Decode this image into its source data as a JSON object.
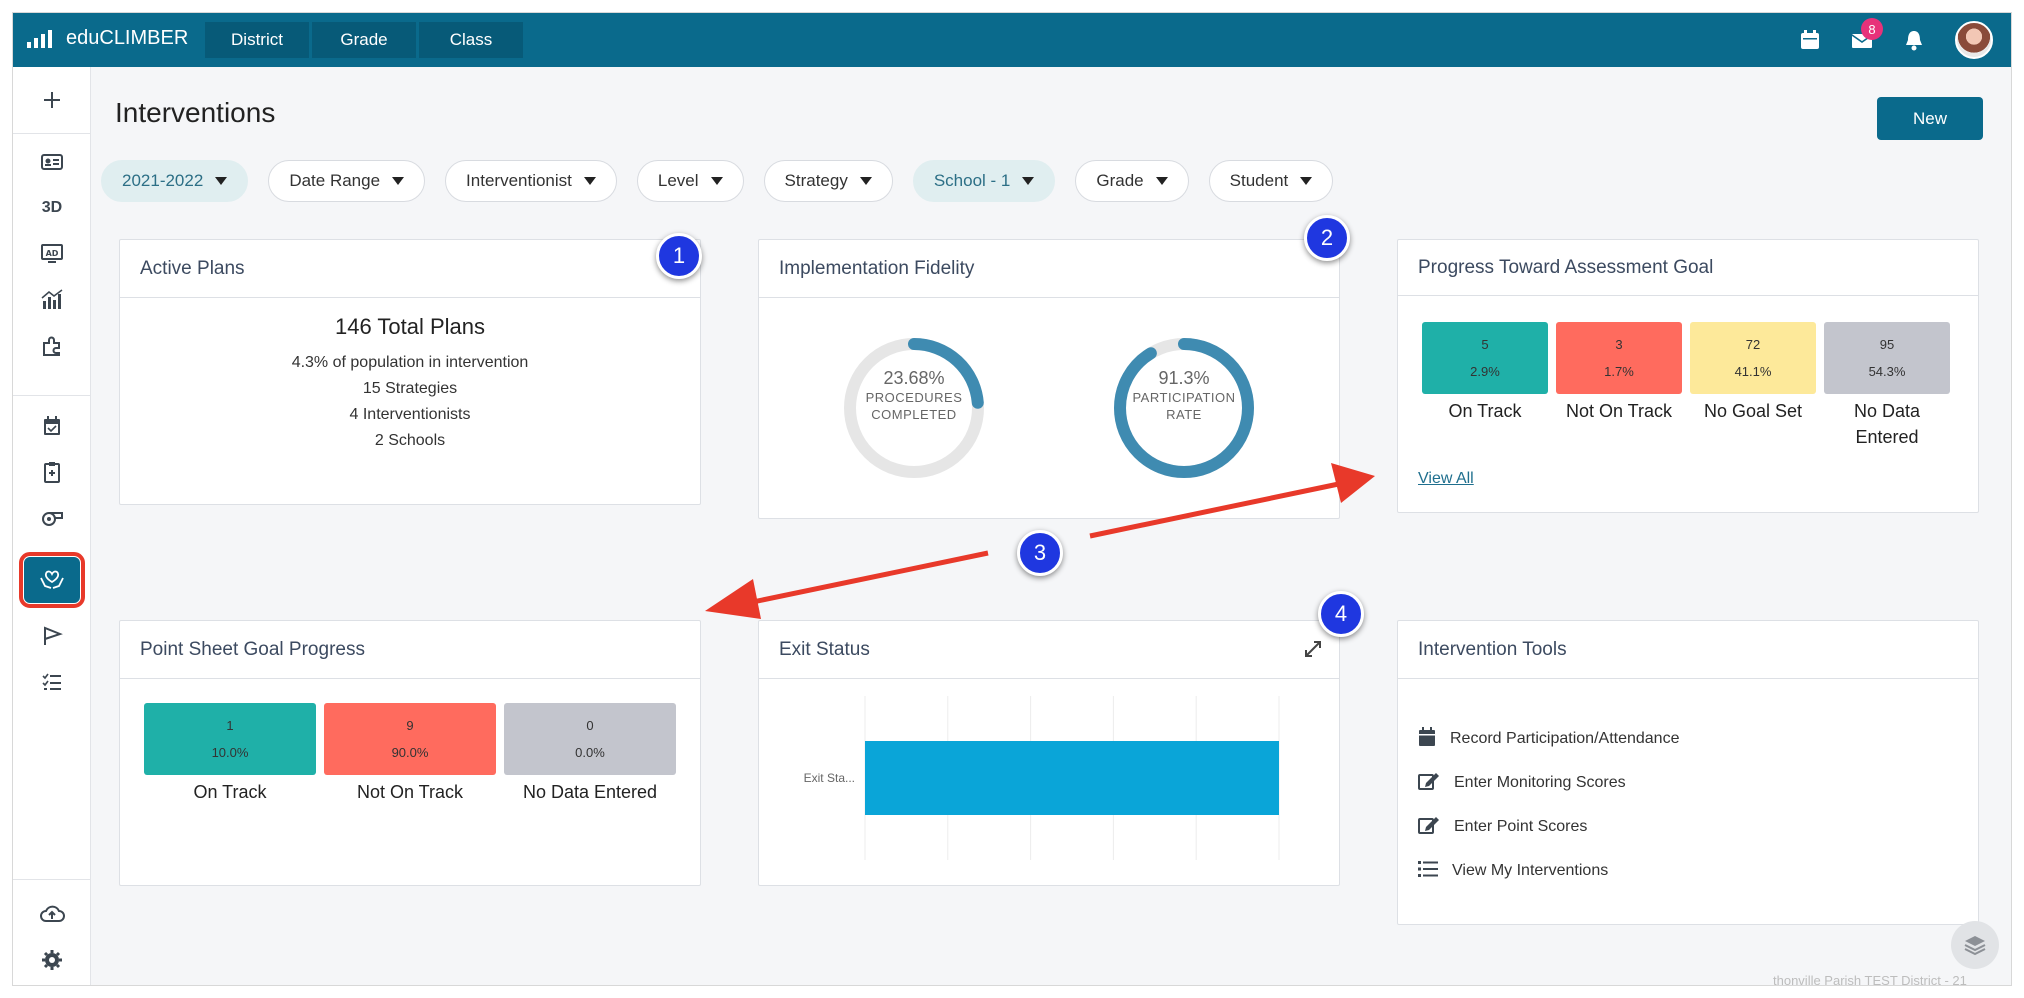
{
  "app": {
    "name": "eduCLIMBER"
  },
  "nav": {
    "tabs": [
      {
        "label": "District"
      },
      {
        "label": "Grade"
      },
      {
        "label": "Class"
      }
    ]
  },
  "header": {
    "notification_count": "8"
  },
  "page": {
    "title": "Interventions",
    "new_label": "New"
  },
  "sidebar": {
    "items": [
      "add",
      "student-card",
      "3D",
      "ad",
      "analytics",
      "puzzle",
      "calendar",
      "clipboard",
      "whistle",
      "interventions",
      "flag",
      "checklist",
      "cloud-upload",
      "settings"
    ],
    "threed_label": "3D"
  },
  "filters": [
    {
      "label": "2021-2022",
      "active": true
    },
    {
      "label": "Date Range",
      "active": false
    },
    {
      "label": "Interventionist",
      "active": false
    },
    {
      "label": "Level",
      "active": false
    },
    {
      "label": "Strategy",
      "active": false
    },
    {
      "label": "School - 1",
      "active": true
    },
    {
      "label": "Grade",
      "active": false
    },
    {
      "label": "Student",
      "active": false
    }
  ],
  "active_plans": {
    "title": "Active Plans",
    "total": "146 Total Plans",
    "lines": [
      "4.3% of population in intervention",
      "15 Strategies",
      "4 Interventionists",
      "2 Schools"
    ]
  },
  "fidelity": {
    "title": "Implementation Fidelity",
    "procedures": {
      "pct": "23.68%",
      "line1": "PROCEDURES",
      "line2": "COMPLETED",
      "value": 0.2368
    },
    "participation": {
      "pct": "91.3%",
      "line1": "PARTICIPATION",
      "line2": "RATE",
      "value": 0.913
    }
  },
  "assessment_goal": {
    "title": "Progress Toward Assessment Goal",
    "tiles": [
      {
        "count": "5",
        "pct": "2.9%",
        "label": "On Track",
        "color": "#1fb0a8"
      },
      {
        "count": "3",
        "pct": "1.7%",
        "label": "Not On Track",
        "color": "#ff6b5e"
      },
      {
        "count": "72",
        "pct": "41.1%",
        "label": "No Goal Set",
        "color": "#fde99a"
      },
      {
        "count": "95",
        "pct": "54.3%",
        "label": "No Data Entered",
        "color": "#c3c5cd"
      }
    ],
    "view_all": "View All"
  },
  "point_sheet": {
    "title": "Point Sheet Goal Progress",
    "tiles": [
      {
        "count": "1",
        "pct": "10.0%",
        "label": "On Track",
        "color": "#1fb0a8"
      },
      {
        "count": "9",
        "pct": "90.0%",
        "label": "Not On Track",
        "color": "#ff6b5e"
      },
      {
        "count": "0",
        "pct": "0.0%",
        "label": "No Data Entered",
        "color": "#c3c5cd"
      }
    ]
  },
  "exit_status": {
    "title": "Exit Status",
    "chart_data": {
      "type": "bar",
      "orientation": "horizontal",
      "categories": [
        "Exit Sta..."
      ],
      "values": [
        1
      ],
      "color": "#0aa5d8",
      "grid": true
    }
  },
  "tools": {
    "title": "Intervention Tools",
    "items": [
      {
        "label": "Record Participation/Attendance",
        "icon": "calendar-icon"
      },
      {
        "label": "Enter Monitoring Scores",
        "icon": "edit-icon"
      },
      {
        "label": "Enter Point Scores",
        "icon": "edit-icon"
      },
      {
        "label": "View My Interventions",
        "icon": "list-icon"
      }
    ]
  },
  "annotations": {
    "markers": [
      "1",
      "2",
      "3",
      "4"
    ],
    "arrow_color": "#e8392a"
  },
  "footer": {
    "text": "thonville Parish TEST District - 21"
  }
}
